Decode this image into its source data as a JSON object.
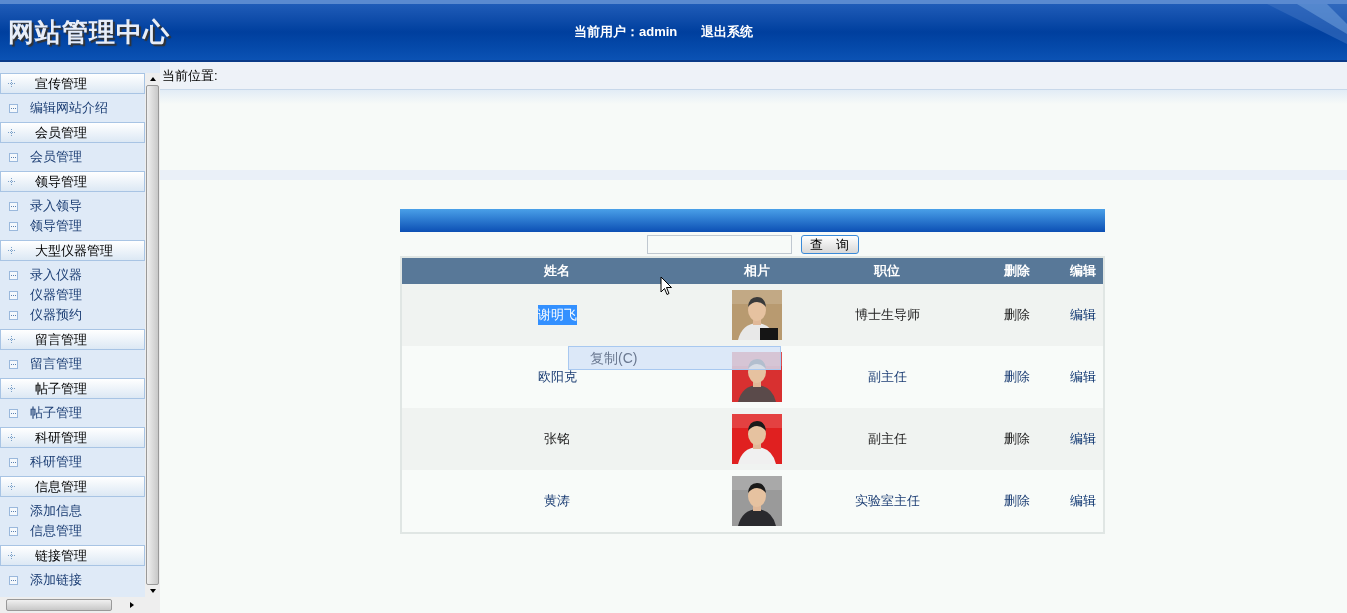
{
  "header": {
    "title": "网站管理中心",
    "user_label": "当前用户：admin",
    "logout": "退出系统"
  },
  "sidebar": {
    "groups": [
      {
        "title": "宣传管理",
        "items": [
          "编辑网站介绍"
        ]
      },
      {
        "title": "会员管理",
        "items": [
          "会员管理"
        ]
      },
      {
        "title": "领导管理",
        "items": [
          "录入领导",
          "领导管理"
        ]
      },
      {
        "title": "大型仪器管理",
        "items": [
          "录入仪器",
          "仪器管理",
          "仪器预约"
        ]
      },
      {
        "title": "留言管理",
        "items": [
          "留言管理"
        ]
      },
      {
        "title": "帖子管理",
        "items": [
          "帖子管理"
        ]
      },
      {
        "title": "科研管理",
        "items": [
          "科研管理"
        ]
      },
      {
        "title": "信息管理",
        "items": [
          "添加信息",
          "信息管理"
        ]
      },
      {
        "title": "链接管理",
        "items": [
          "添加链接"
        ]
      }
    ]
  },
  "breadcrumb": "当前位置:",
  "search": {
    "button": "查　询"
  },
  "table": {
    "columns": [
      "姓名",
      "相片",
      "职位",
      "删除",
      "编辑"
    ],
    "rows": [
      {
        "name": "谢明飞",
        "name_selected": true,
        "position": "博士生导师",
        "delete": "删除",
        "edit": "编辑"
      },
      {
        "name": "欧阳克",
        "name_selected": false,
        "position": "副主任",
        "delete": "删除",
        "edit": "编辑"
      },
      {
        "name": "张铭",
        "name_selected": false,
        "position": "副主任",
        "delete": "删除",
        "edit": "编辑"
      },
      {
        "name": "黄涛",
        "name_selected": false,
        "position": "实验室主任",
        "delete": "删除",
        "edit": "编辑"
      }
    ]
  },
  "context_menu": {
    "items": [
      "复制(C)"
    ]
  }
}
